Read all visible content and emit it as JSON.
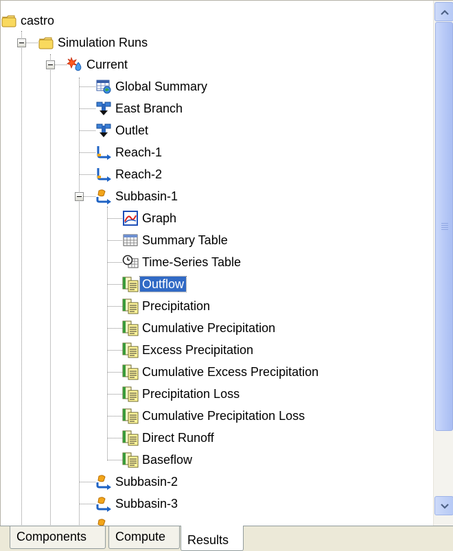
{
  "tree": {
    "root": {
      "label": "castro",
      "icon": "folder-icon"
    },
    "simulation_runs": {
      "label": "Simulation Runs",
      "icon": "folder-icon"
    },
    "current": {
      "label": "Current",
      "icon": "run-icon"
    },
    "elements": [
      {
        "label": "Global Summary",
        "icon": "global-summary-icon"
      },
      {
        "label": "East Branch",
        "icon": "junction-icon"
      },
      {
        "label": "Outlet",
        "icon": "junction-icon"
      },
      {
        "label": "Reach-1",
        "icon": "reach-icon"
      },
      {
        "label": "Reach-2",
        "icon": "reach-icon"
      }
    ],
    "subbasin_1": {
      "label": "Subbasin-1",
      "icon": "subbasin-icon",
      "children": [
        {
          "label": "Graph",
          "icon": "graph-icon"
        },
        {
          "label": "Summary Table",
          "icon": "table-icon"
        },
        {
          "label": "Time-Series Table",
          "icon": "time-series-table-icon"
        },
        {
          "label": "Outflow",
          "icon": "time-series-icon",
          "selected": true
        },
        {
          "label": "Precipitation",
          "icon": "time-series-icon"
        },
        {
          "label": "Cumulative Precipitation",
          "icon": "time-series-icon"
        },
        {
          "label": "Excess Precipitation",
          "icon": "time-series-icon"
        },
        {
          "label": "Cumulative Excess Precipitation",
          "icon": "time-series-icon"
        },
        {
          "label": "Precipitation Loss",
          "icon": "time-series-icon"
        },
        {
          "label": "Cumulative Precipitation Loss",
          "icon": "time-series-icon"
        },
        {
          "label": "Direct Runoff",
          "icon": "time-series-icon"
        },
        {
          "label": "Baseflow",
          "icon": "time-series-icon"
        }
      ]
    },
    "after": [
      {
        "label": "Subbasin-2",
        "icon": "subbasin-icon"
      },
      {
        "label": "Subbasin-3",
        "icon": "subbasin-icon"
      }
    ]
  },
  "tabs": [
    {
      "label": "Components",
      "active": false
    },
    {
      "label": "Compute",
      "active": false
    },
    {
      "label": "Results",
      "active": true
    }
  ],
  "colors": {
    "selection": "#316ac5",
    "tab_bar": "#ece9d8",
    "scrollbar_thumb": "#b5c7f6"
  }
}
